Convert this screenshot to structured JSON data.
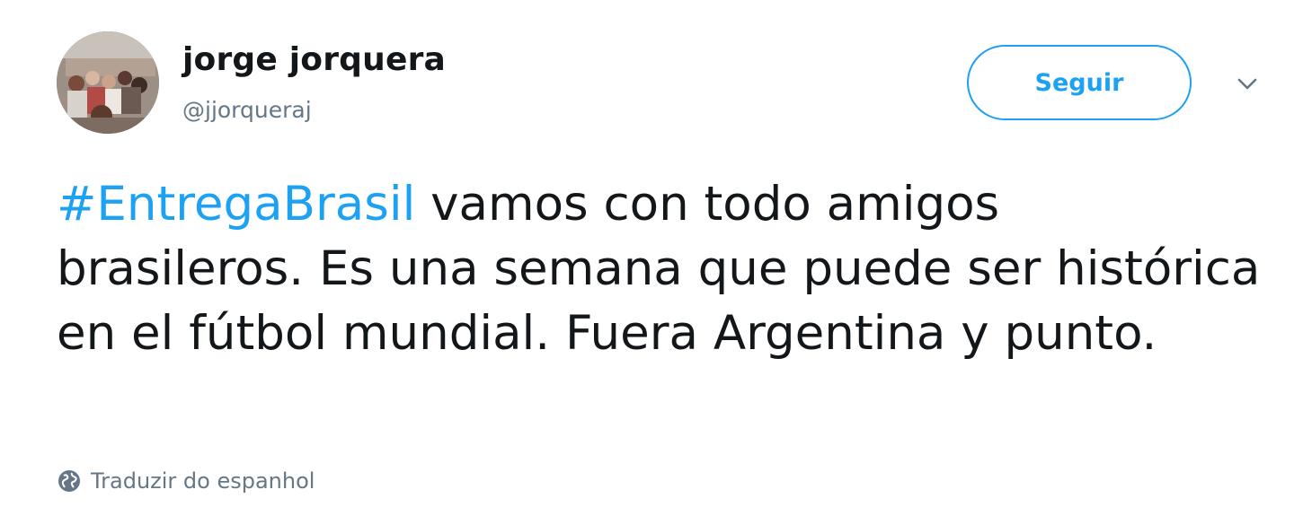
{
  "user": {
    "display_name": "jorge jorquera",
    "handle": "@jjorqueraj"
  },
  "follow_label": "Seguir",
  "tweet": {
    "hashtag": "#EntregaBrasil",
    "text_after_hashtag": " vamos con todo amigos brasileros. Es una semana que puede ser histórica en el fútbol mundial. Fuera Argentina y punto."
  },
  "translate_label": "Traduzir do espanhol",
  "colors": {
    "accent": "#1da1f2",
    "text": "#14171a",
    "secondary": "#657786"
  },
  "icons": {
    "caret": "chevron-down-icon",
    "translate": "globe-icon"
  }
}
